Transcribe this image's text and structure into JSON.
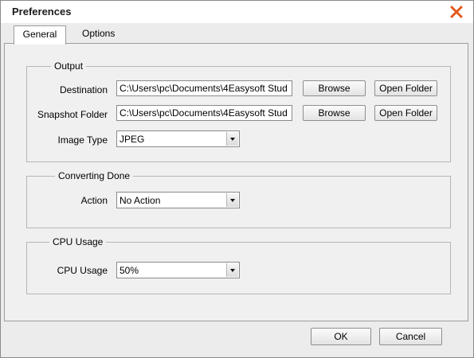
{
  "window": {
    "title": "Preferences"
  },
  "tabs": [
    {
      "label": "General",
      "active": true
    },
    {
      "label": "Options",
      "active": false
    }
  ],
  "output": {
    "title": "Output",
    "destination": {
      "label": "Destination",
      "value": "C:\\Users\\pc\\Documents\\4Easysoft Stud",
      "browse": "Browse",
      "open_folder": "Open Folder"
    },
    "snapshot": {
      "label": "Snapshot Folder",
      "value": "C:\\Users\\pc\\Documents\\4Easysoft Stud",
      "browse": "Browse",
      "open_folder": "Open Folder"
    },
    "image_type": {
      "label": "Image Type",
      "value": "JPEG"
    }
  },
  "converting_done": {
    "title": "Converting Done",
    "action": {
      "label": "Action",
      "value": "No Action"
    }
  },
  "cpu_usage": {
    "title": "CPU Usage",
    "field": {
      "label": "CPU Usage",
      "value": "50%"
    }
  },
  "footer": {
    "ok": "OK",
    "cancel": "Cancel"
  },
  "colors": {
    "close_icon": "#e05a1e"
  }
}
